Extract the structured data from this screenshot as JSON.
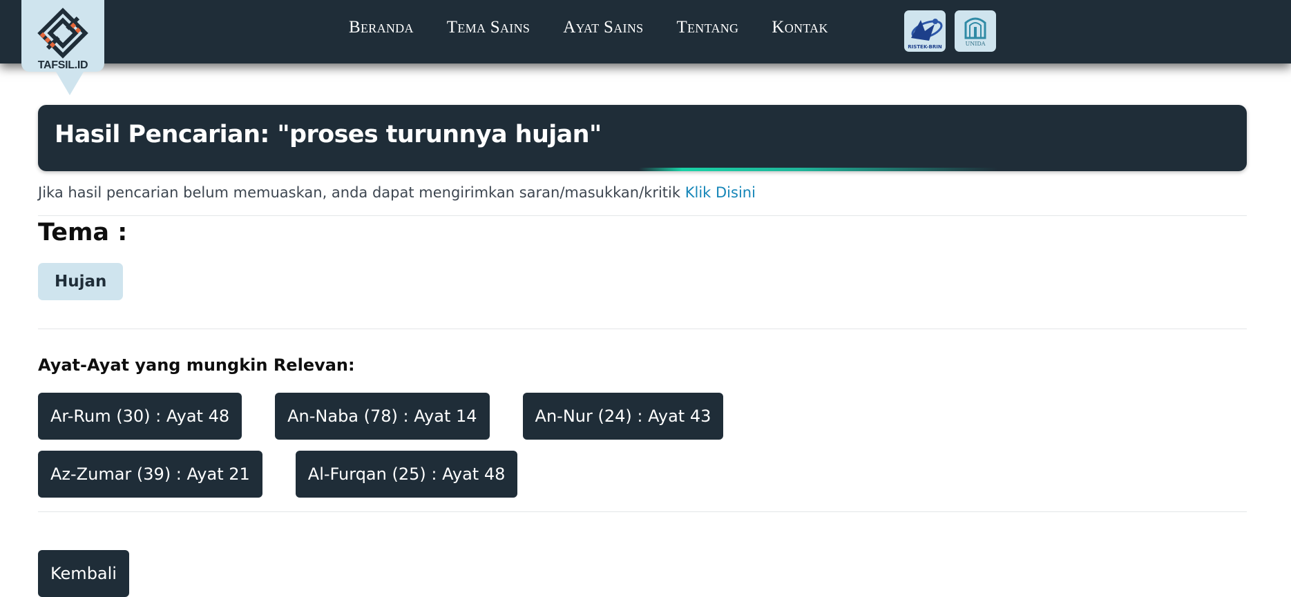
{
  "brand": {
    "name": "TAFSIL.ID"
  },
  "nav": {
    "links": [
      "Beranda",
      "Tema Sains",
      "Ayat Sains",
      "Tentang",
      "Kontak"
    ]
  },
  "partners": [
    {
      "label": "RISTEK-BRIN",
      "icon": "ristek-brin-logo"
    },
    {
      "label": "UNIDA",
      "icon": "unida-logo"
    }
  ],
  "header": {
    "title": "Hasil Pencarian: \"proses turunnya hujan\""
  },
  "notice": {
    "text": "Jika hasil pencarian belum memuaskan, anda dapat mengirimkan saran/masukkan/kritik",
    "link_label": "Klik Disini"
  },
  "theme": {
    "heading": "Tema :",
    "tags": [
      "Hujan"
    ]
  },
  "verses": {
    "heading": "Ayat-Ayat yang mungkin Relevan:",
    "items": [
      "Ar-Rum (30) : Ayat 48",
      "An-Naba (78) : Ayat 14",
      "An-Nur (24) : Ayat 43",
      "Az-Zumar (39) : Ayat 21",
      "Al-Furqan (25) : Ayat 48"
    ]
  },
  "actions": {
    "back_label": "Kembali"
  },
  "colors": {
    "primary": "#1f2d38",
    "accent_light": "#cfe4ee",
    "link": "#1686b8",
    "highlight": "#19d1a6"
  }
}
